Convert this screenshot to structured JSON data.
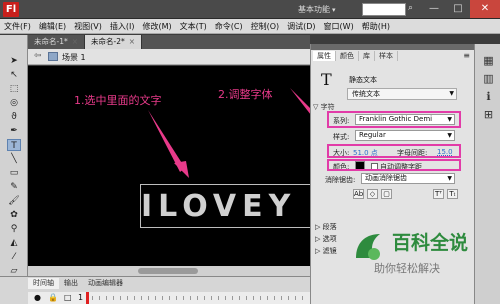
{
  "titlebar": {
    "app_logo": "Fl",
    "workspace_label": "基本功能",
    "window_buttons": [
      "—",
      "□",
      "✕"
    ]
  },
  "menu": [
    "文件(F)",
    "编辑(E)",
    "视图(V)",
    "插入(I)",
    "修改(M)",
    "文本(T)",
    "命令(C)",
    "控制(O)",
    "调试(D)",
    "窗口(W)",
    "帮助(H)"
  ],
  "tabs": [
    {
      "label": "未命名-1*",
      "active": false
    },
    {
      "label": "未命名-2*",
      "active": true
    }
  ],
  "editbar": {
    "scene_label": "场景 1"
  },
  "stage": {
    "text": "ILOVEY",
    "annotation_1": "1.选中里面的文字",
    "annotation_2": "2.调整字体",
    "annotation_color": "#e83a8a"
  },
  "timeline": {
    "tabs": [
      "时间轴",
      "输出",
      "动画编辑器"
    ],
    "frame_marker": "1"
  },
  "properties": {
    "tabs": [
      "属性",
      "颜色",
      "库",
      "样本"
    ],
    "tool_icon": "T",
    "tool_name": "静态文本",
    "text_type": "传统文本",
    "char_section": "字符",
    "family_label": "系列:",
    "family_value": "Franklin Gothic Demi",
    "style_label": "样式:",
    "style_value": "Regular",
    "size_label": "大小:",
    "size_value": "51.0 点",
    "spacing_label": "字母间距:",
    "spacing_value": "15.0",
    "color_label": "颜色:",
    "auto_kern_label": "自动调整字距",
    "aa_label": "消除锯齿:",
    "aa_value": "动画消除锯齿",
    "collapsed_sections": [
      "段落",
      "选项",
      "滤镜"
    ],
    "highlight_color": "#e23ba8"
  },
  "watermark": {
    "title": "百科全说",
    "subtitle": "助你轻松解决",
    "color": "#2e8b3e"
  }
}
